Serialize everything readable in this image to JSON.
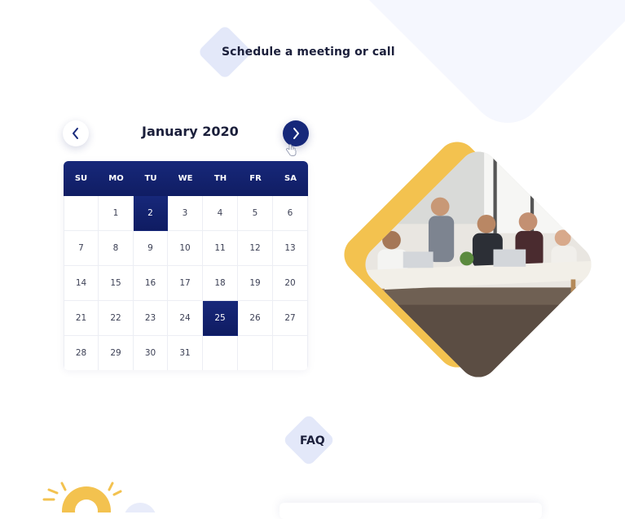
{
  "section": {
    "title": "Schedule a meeting or call"
  },
  "calendar": {
    "month_label": "January 2020",
    "weekdays": [
      "SU",
      "MO",
      "TU",
      "WE",
      "TH",
      "FR",
      "SA"
    ],
    "selected_days": [
      2,
      25
    ],
    "leading_blanks": 1,
    "days_in_month": 31,
    "header_color": "#16287a"
  },
  "photo": {
    "description_icon": "meeting-photo",
    "accent_color": "#f3c24f"
  },
  "faq": {
    "title": "FAQ"
  }
}
